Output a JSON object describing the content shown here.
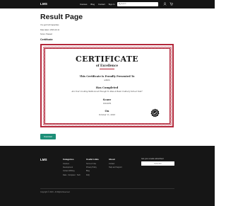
{
  "header": {
    "logo": "LMS",
    "nav": [
      "Courses",
      "Blog",
      "Contact",
      "Sign In"
    ],
    "search_placeholder": "Search",
    "icons": [
      "search-icon",
      "user-icon",
      "cart-icon",
      "menu-icon"
    ]
  },
  "page": {
    "title": "Result Page",
    "meta": [
      "You got Full Capacities",
      "Date taken: 2023-10-11",
      "Score: Passed"
    ],
    "certificate_label": "Certificate"
  },
  "certificate": {
    "title": "CERTIFICATE",
    "subtitle": "of Excellence",
    "presented_heading": "This Certificate is Proudly Presented To",
    "recipient": "admin",
    "completed_heading": "Has Completed",
    "quiz_name": "Are Your Cooking Skills Good Enough To Pass A Basic Culinary School Test?",
    "score_heading": "Score",
    "score_value": "100.00%",
    "date_heading": "On",
    "date_value": "October 11, 2023",
    "accent_color": "#b3273a"
  },
  "actions": {
    "download_label": "Download"
  },
  "footer": {
    "logo": "LMS",
    "categories": {
      "heading": "Categories",
      "items": [
        "Courses",
        "Development",
        "Content Writing",
        "Data · Computer · Tech"
      ]
    },
    "useful_links": {
      "heading": "Useful Links",
      "items": [
        "Terms of Use",
        "Privacy Policy",
        "Blog",
        "FAQ"
      ]
    },
    "about": {
      "heading": "About",
      "items": [
        "Contact",
        "Help and Support"
      ]
    },
    "subscribe_label": "Get your emails subscribed",
    "subscribe_button": "Subscribe",
    "copyright": "Copyright © 2023 - All Rights Reserved"
  }
}
